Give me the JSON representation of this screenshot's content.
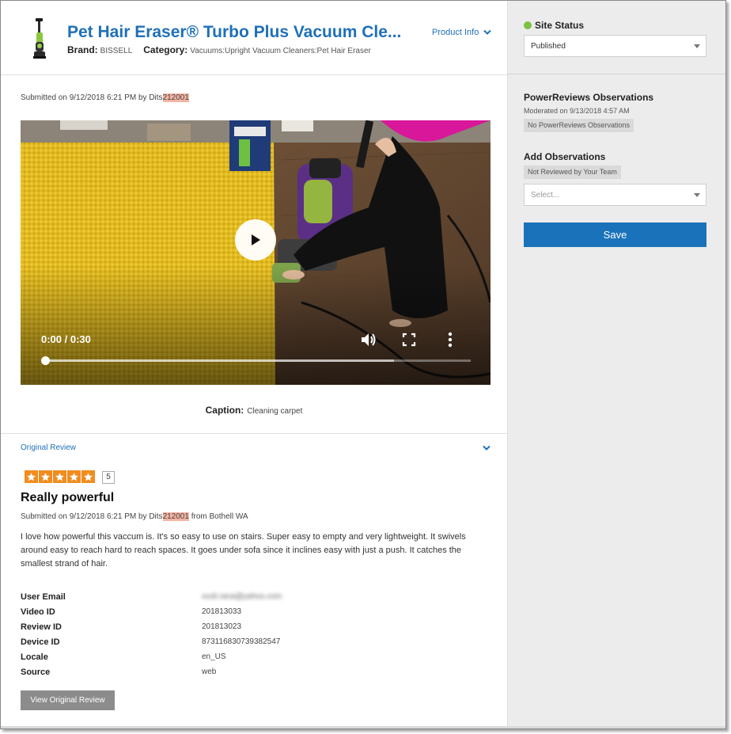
{
  "product": {
    "title": "Pet Hair Eraser® Turbo Plus Vacuum Cle...",
    "brand_label": "Brand:",
    "brand": "BISSELL",
    "category_label": "Category:",
    "category": "Vacuums:Upright Vacuum Cleaners:Pet Hair Eraser",
    "info_link": "Product Info"
  },
  "media": {
    "submitted_prefix": "Submitted on 9/12/2018 6:21 PM by Dits",
    "submitted_id": "212001",
    "time": "0:00 / 0:30",
    "progress_fraction": 0,
    "caption_label": "Caption:",
    "caption": "Cleaning carpet"
  },
  "review": {
    "section_link": "Original Review",
    "rating": "5",
    "stars": 5,
    "title": "Really powerful",
    "submitted_prefix": "Submitted on 9/12/2018 6:21 PM by Dits",
    "submitted_id": "212001",
    "submitted_suffix": " from Bothell WA",
    "body": "I love how powerful this vaccum is. It's so easy to use on stairs. Super easy to empty and very lightweight. It swivels around easy to reach hard to reach spaces. It goes under sofa since it inclines easy with just a push. It catches the smallest strand of hair.",
    "details": [
      {
        "key": "User Email",
        "value": "xxxli.rana@yahoo.com",
        "blurred": true
      },
      {
        "key": "Video ID",
        "value": "201813033"
      },
      {
        "key": "Review ID",
        "value": "201813023"
      },
      {
        "key": "Device ID",
        "value": "873116830739382547"
      },
      {
        "key": "Locale",
        "value": "en_US"
      },
      {
        "key": "Source",
        "value": "web"
      }
    ],
    "view_button": "View Original Review"
  },
  "sidebar": {
    "site_status_label": "Site Status",
    "site_status_value": "Published",
    "status_color": "#7bc143",
    "observations_title": "PowerReviews Observations",
    "moderated": "Moderated on 9/13/2018 4:57 AM",
    "observations_tag": "No PowerReviews Observations",
    "add_title": "Add Observations",
    "add_tag": "Not Reviewed by Your Team",
    "add_placeholder": "Select...",
    "save_label": "Save",
    "accent": "#1a73ba"
  }
}
